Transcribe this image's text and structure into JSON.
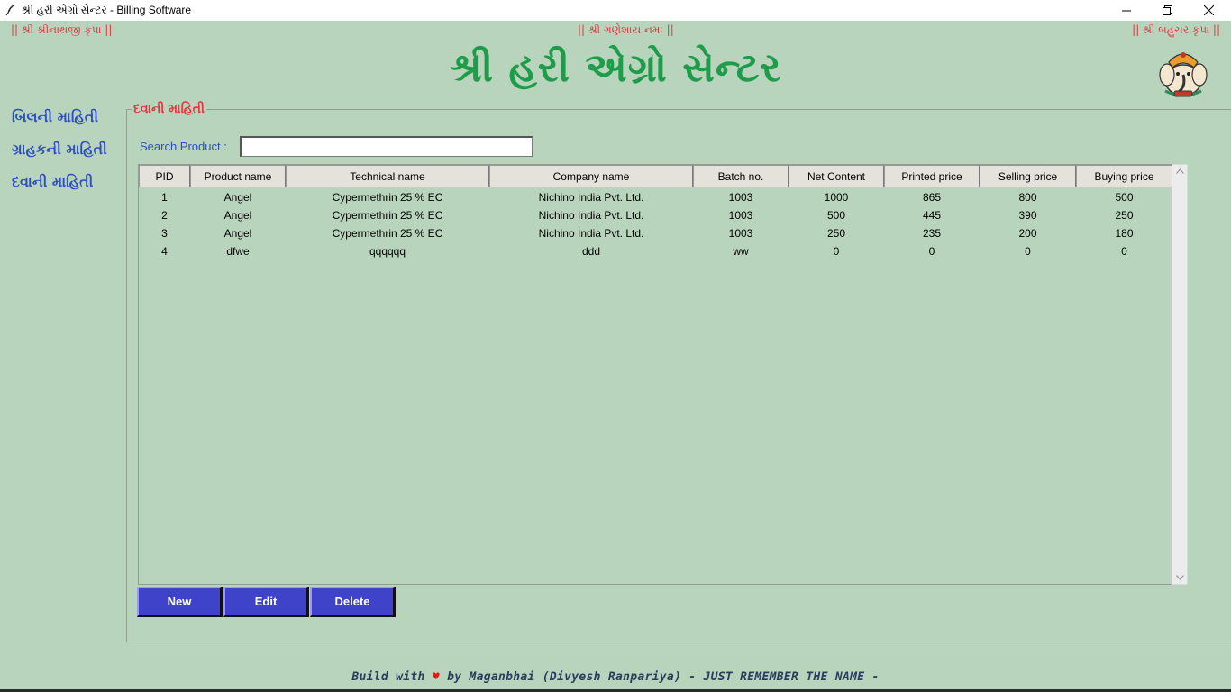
{
  "window": {
    "title": "શ્રી હરી એગ્રો સેન્ટર - Billing Software",
    "icon": "feather-icon",
    "controls": {
      "minimize": "minimize-icon",
      "restore": "restore-icon",
      "close": "close-icon"
    }
  },
  "blessings": {
    "left": "|| શ્રી શ્રીનાથજી કૃપા ||",
    "center": "|| શ્રી ગણેશાય નમઃ ||",
    "right": "|| શ્રી બહુચર કૃપા ||"
  },
  "header": {
    "title": "શ્રી હરી એગ્રો સેન્ટર"
  },
  "sidebar": {
    "items": [
      {
        "label": "બિલની માહિતી"
      },
      {
        "label": "ગ્રાહકની માહિતી"
      },
      {
        "label": "દવાની માહિતી"
      }
    ]
  },
  "main": {
    "group_title": "દવાની માહિતી",
    "search": {
      "label": "Search Product :",
      "value": "",
      "placeholder": ""
    },
    "table": {
      "columns": [
        "PID",
        "Product name",
        "Technical name",
        "Company name",
        "Batch no.",
        "Net Content",
        "Printed price",
        "Selling price",
        "Buying price"
      ],
      "rows": [
        [
          "1",
          "Angel",
          "Cypermethrin 25 % EC",
          "Nichino India Pvt. Ltd.",
          "1003",
          "1000",
          "865",
          "800",
          "500"
        ],
        [
          "2",
          "Angel",
          "Cypermethrin 25 % EC",
          "Nichino India Pvt. Ltd.",
          "1003",
          "500",
          "445",
          "390",
          "250"
        ],
        [
          "3",
          "Angel",
          "Cypermethrin 25 % EC",
          "Nichino India Pvt. Ltd.",
          "1003",
          "250",
          "235",
          "200",
          "180"
        ],
        [
          "4",
          "dfwe",
          "qqqqqq",
          "ddd",
          "ww",
          "0",
          "0",
          "0",
          "0"
        ]
      ]
    },
    "buttons": {
      "new": "New",
      "edit": "Edit",
      "delete": "Delete"
    }
  },
  "footer": {
    "prefix": "Build with",
    "heart": "♥",
    "suffix": "by Maganbhai (Divyesh Ranpariya) - JUST REMEMBER THE NAME -"
  },
  "colors": {
    "background": "#b8d4bd",
    "title_green": "#1f9c4a",
    "accent_red": "#e0383e",
    "nav_blue": "#2e4fbf",
    "button_blue": "#3f43c9"
  }
}
